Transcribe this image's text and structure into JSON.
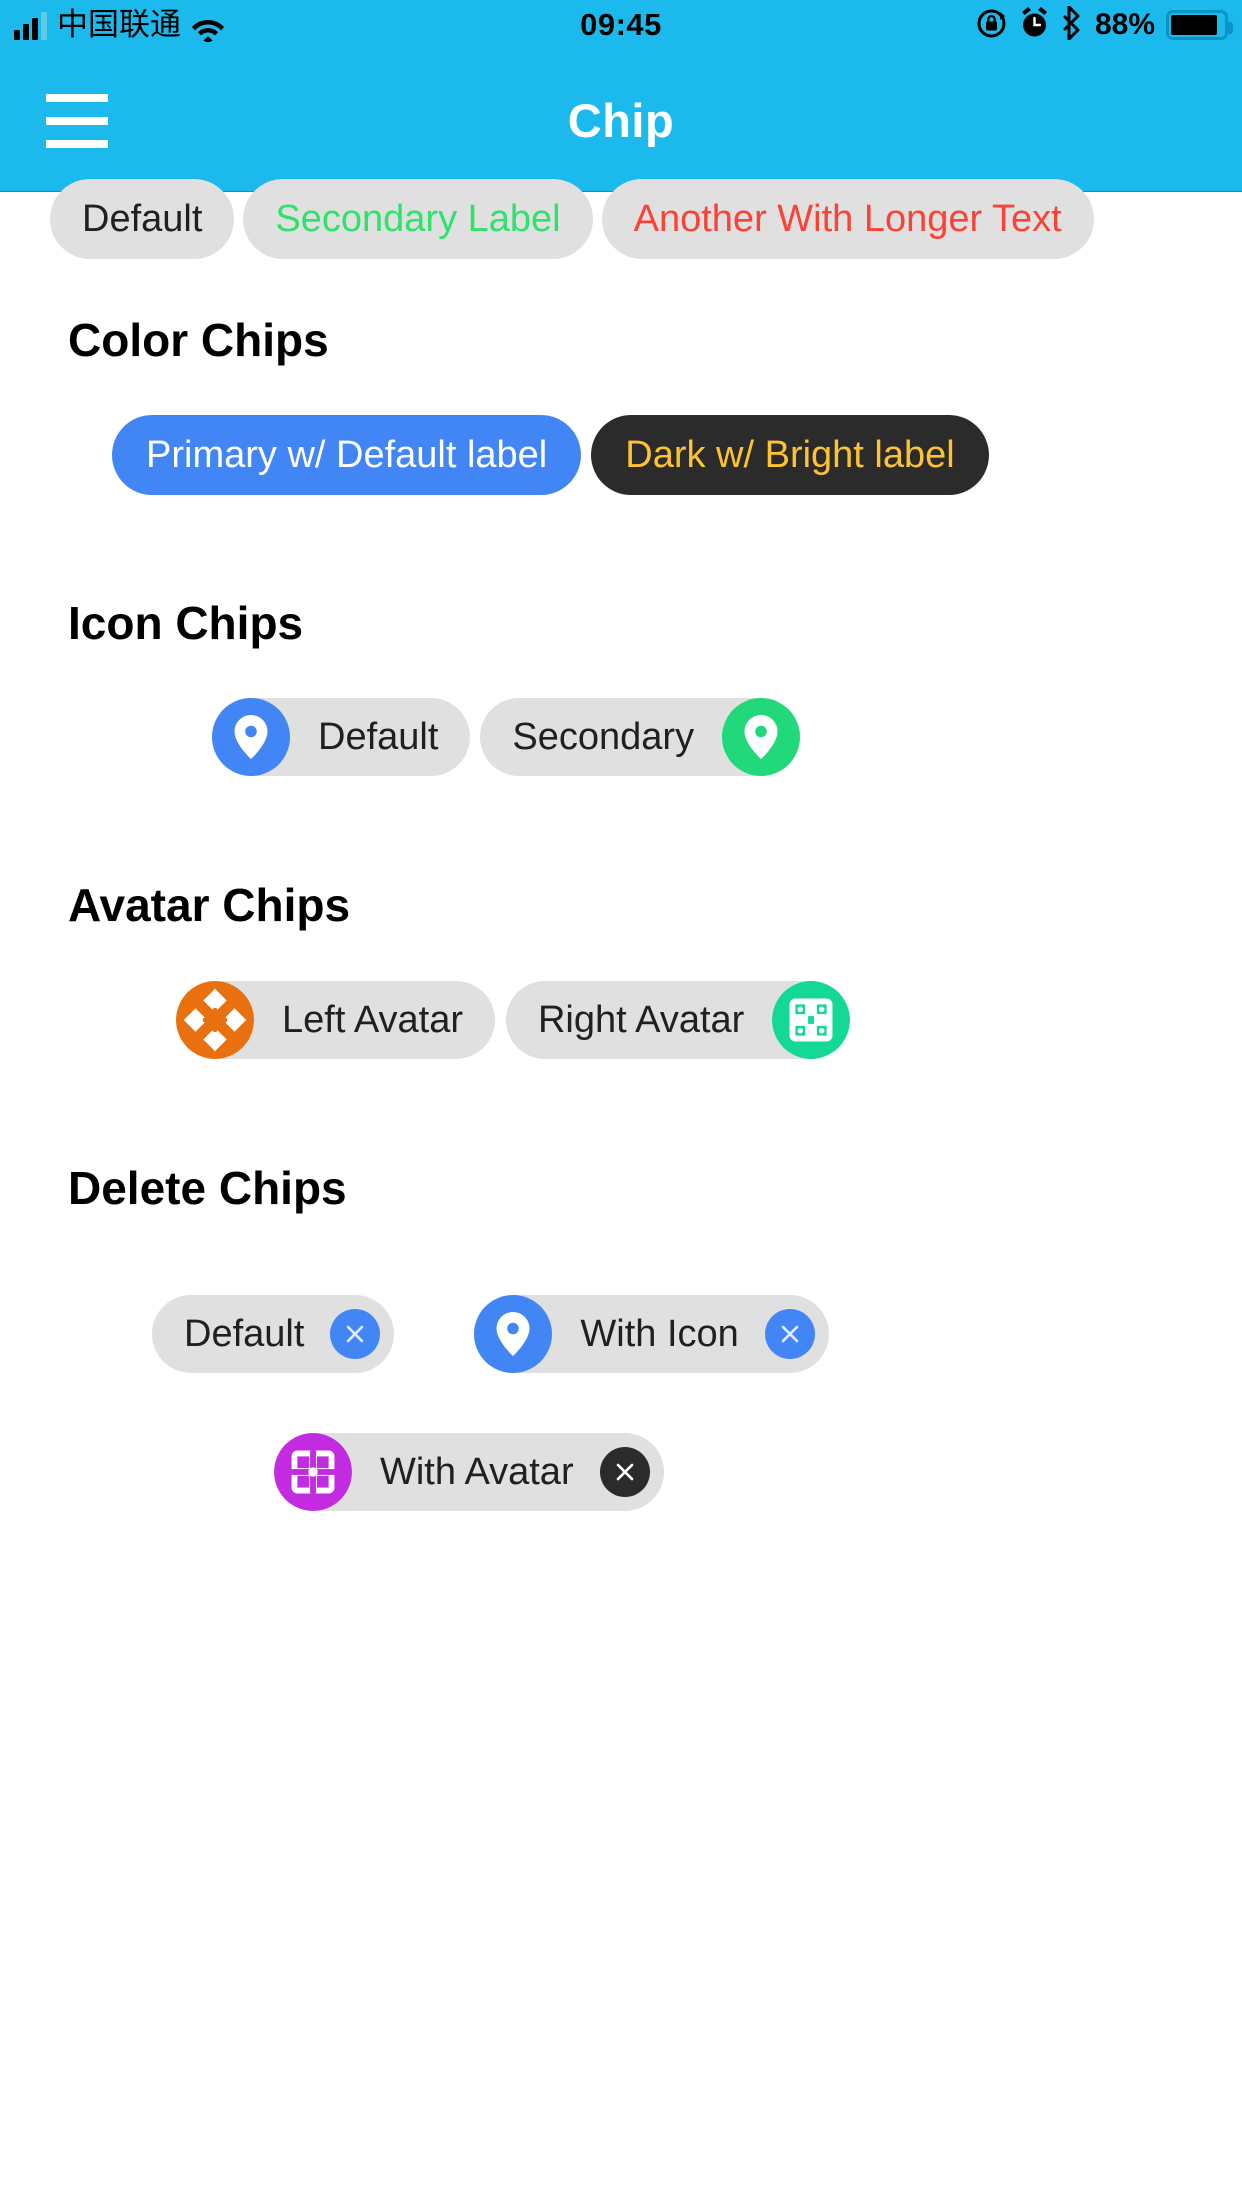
{
  "theme": {
    "brand": "#1CB9EC",
    "chip_bg": "#E0E0E0",
    "primary_blue": "#4285F4",
    "dark_chip": "#2B2B2B",
    "amber_text": "#FFC233",
    "green_text": "#2EE36B",
    "red_text": "#FA4336",
    "green_icon": "#21D97B",
    "orange_avatar": "#E8700E",
    "teal_avatar": "#14D996",
    "purple_avatar": "#C22BE0",
    "dark_delete": "#2B2B2B"
  },
  "statusbar": {
    "carrier": "中国联通",
    "time": "09:45",
    "battery_percent": "88%",
    "icons": {
      "signal": "signal-bars-icon",
      "wifi": "wifi-icon",
      "rotation_lock": "rotation-lock-icon",
      "alarm": "alarm-clock-icon",
      "bluetooth": "bluetooth-icon",
      "battery": "battery-icon"
    }
  },
  "header": {
    "title": "Chip",
    "menu_icon": "hamburger-menu-icon"
  },
  "basic_chips": [
    {
      "label": "Default",
      "text_color": "#202020"
    },
    {
      "label": "Secondary Label",
      "text_color": "#2EE36B"
    },
    {
      "label": "Another With Longer Text",
      "text_color": "#FA4336"
    }
  ],
  "sections": [
    {
      "title": "Color Chips",
      "chips": [
        {
          "label": "Primary w/ Default label",
          "bg": "#4285F4",
          "text_color": "#FFFFFF"
        },
        {
          "label": "Dark w/ Bright label",
          "bg": "#2B2B2B",
          "text_color": "#FFC233"
        }
      ]
    },
    {
      "title": "Icon Chips",
      "chips": [
        {
          "label": "Default",
          "icon": "location-pin-icon",
          "icon_side": "left",
          "icon_bg": "#4285F4"
        },
        {
          "label": "Secondary",
          "icon": "location-pin-icon",
          "icon_side": "right",
          "icon_bg": "#21D97B"
        }
      ]
    },
    {
      "title": "Avatar Chips",
      "chips": [
        {
          "label": "Left Avatar",
          "avatar": "orange-identicon-avatar",
          "avatar_side": "left"
        },
        {
          "label": "Right Avatar",
          "avatar": "teal-identicon-avatar",
          "avatar_side": "right"
        }
      ]
    },
    {
      "title": "Delete Chips",
      "chips": [
        {
          "label": "Default",
          "delete_icon": "close-circle-icon",
          "delete_bg": "#4285F4"
        },
        {
          "label": "With Icon",
          "icon": "location-pin-icon",
          "icon_bg": "#4285F4",
          "delete_icon": "close-circle-icon",
          "delete_bg": "#4285F4"
        },
        {
          "label": "With Avatar",
          "avatar": "purple-identicon-avatar",
          "delete_icon": "close-circle-icon",
          "delete_bg": "#2B2B2B"
        }
      ]
    }
  ]
}
